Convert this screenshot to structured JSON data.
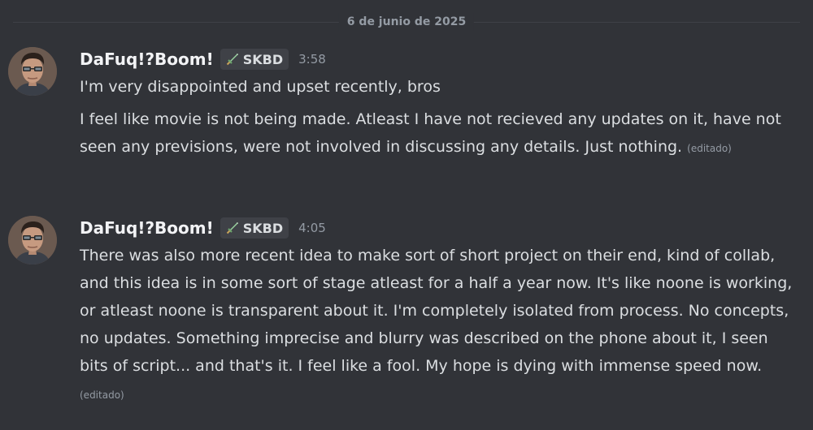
{
  "date_divider": "6 de junio de 2025",
  "messages": [
    {
      "username": "DaFuq!?Boom!",
      "tag": "SKBD",
      "time": "3:58",
      "lines": [
        "I'm very disappointed and upset recently, bros",
        "I feel like movie is not being made. Atleast I have not recieved any updates on it, have not seen any previsions, were not involved in discussing any details. Just nothing."
      ],
      "edited": "(editado)"
    },
    {
      "username": "DaFuq!?Boom!",
      "tag": "SKBD",
      "time": "4:05",
      "lines": [
        "There was also more recent idea to make sort of short project on their end, kind of collab, and this idea is in some sort of stage atleast for a half a year now. It's like noone is working, or atleast noone is transparent about it. I'm completely isolated from process. No concepts, no updates. Something imprecise and blurry was described on the phone about it, I seen bits of script... and that's it. I feel like a fool. My hope is dying with immense speed now."
      ],
      "edited": "(editado)"
    }
  ],
  "colors": {
    "background": "#313338",
    "text": "#dbdee1",
    "muted": "#949ba4",
    "username": "#f2f3f5",
    "tag_bg": "#3f4147"
  },
  "icons": {
    "avatar": "avatar-man-with-glasses",
    "tag_icon": "sword-icon"
  }
}
